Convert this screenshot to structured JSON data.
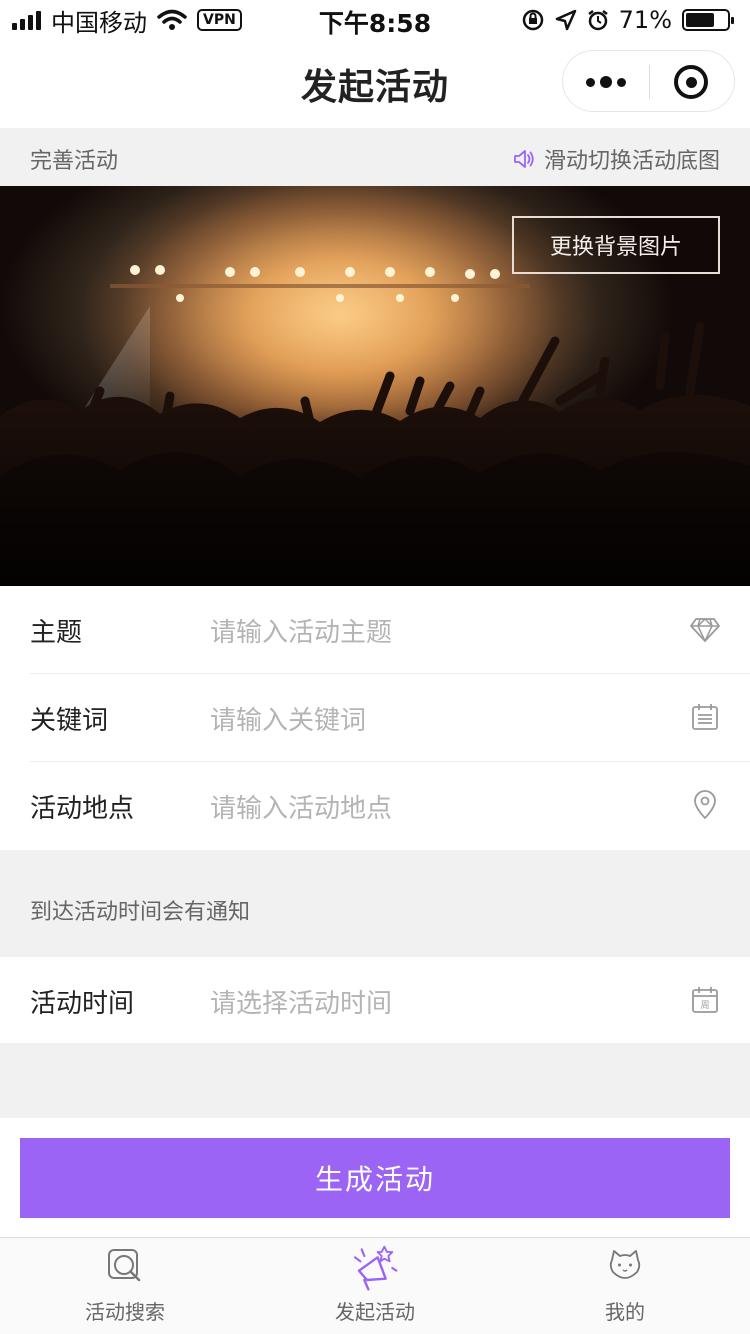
{
  "status_bar": {
    "carrier": "中国移动",
    "vpn": "VPN",
    "time": "下午8:58",
    "battery": "71%",
    "battery_level": 0.71
  },
  "nav": {
    "title": "发起活动"
  },
  "info_strip": {
    "left": "完善活动",
    "right": "滑动切换活动底图",
    "accent_color": "#9b64f5"
  },
  "hero": {
    "change_button": "更换背景图片"
  },
  "form": {
    "rows": [
      {
        "label": "主题",
        "placeholder": "请输入活动主题",
        "icon": "diamond-icon"
      },
      {
        "label": "关键词",
        "placeholder": "请输入关键词",
        "icon": "notepad-icon"
      },
      {
        "label": "活动地点",
        "placeholder": "请输入活动地点",
        "icon": "location-pin-icon"
      }
    ],
    "notice": "到达活动时间会有通知",
    "time_row": {
      "label": "活动时间",
      "placeholder": "请选择活动时间",
      "icon": "calendar-icon",
      "calendar_glyph": "周"
    }
  },
  "generate_button": {
    "label": "生成活动",
    "color": "#9b64f5"
  },
  "tab_bar": {
    "tabs": [
      {
        "label": "活动搜索",
        "icon": "search-icon"
      },
      {
        "label": "发起活动",
        "icon": "megaphone-icon",
        "active": true
      },
      {
        "label": "我的",
        "icon": "cat-face-icon"
      }
    ]
  }
}
